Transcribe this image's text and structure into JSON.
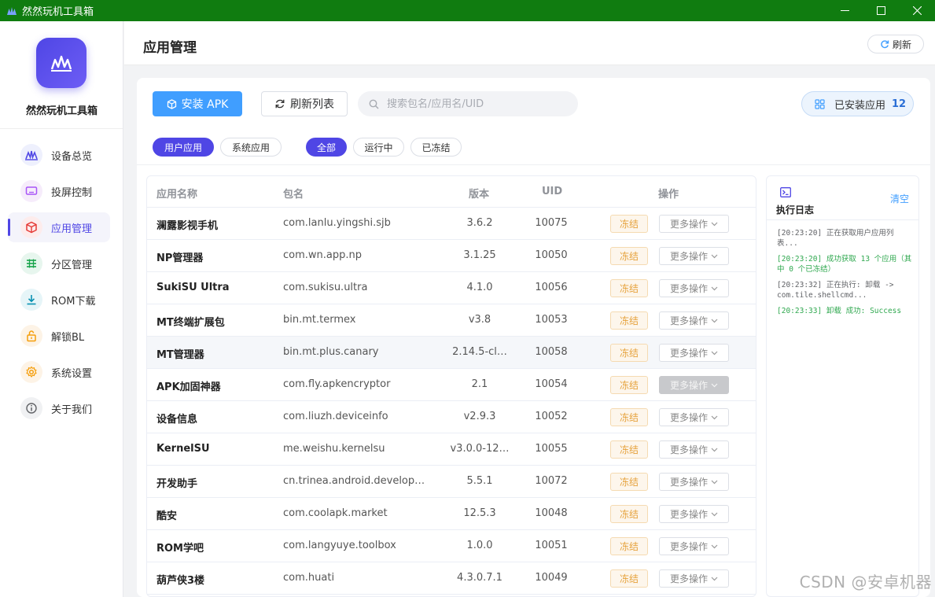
{
  "window": {
    "title": "然然玩机工具箱",
    "minimize_icon": "minimize-icon",
    "maximize_icon": "maximize-icon",
    "close_icon": "close-icon",
    "titlebar_color": "#107c10"
  },
  "sidebar": {
    "logo_title": "然然玩机工具箱",
    "accent": "#4f46e5",
    "items": [
      {
        "label": "设备总览",
        "icon": "chart-icon",
        "active": false
      },
      {
        "label": "投屏控制",
        "icon": "screen-icon",
        "active": false
      },
      {
        "label": "应用管理",
        "icon": "cube-icon",
        "active": true
      },
      {
        "label": "分区管理",
        "icon": "partition-icon",
        "active": false
      },
      {
        "label": "ROM下载",
        "icon": "download-icon",
        "active": false
      },
      {
        "label": "解锁BL",
        "icon": "unlock-icon",
        "active": false
      },
      {
        "label": "系统设置",
        "icon": "gear-icon",
        "active": false
      },
      {
        "label": "关于我们",
        "icon": "info-icon",
        "active": false
      }
    ]
  },
  "header": {
    "title": "应用管理",
    "refresh_label": "刷新"
  },
  "toolbar": {
    "install_label": "安装 APK",
    "refresh_list_label": "刷新列表",
    "search_placeholder": "搜索包名/应用名/UID",
    "search_value": "",
    "installed_label": "已安装应用",
    "installed_count": "12"
  },
  "filters": {
    "type": [
      {
        "label": "用户应用",
        "active": true
      },
      {
        "label": "系统应用",
        "active": false
      }
    ],
    "status": [
      {
        "label": "全部",
        "active": true
      },
      {
        "label": "运行中",
        "active": false
      },
      {
        "label": "已冻结",
        "active": false
      }
    ]
  },
  "table": {
    "columns": [
      "应用名称",
      "包名",
      "版本",
      "UID",
      "操作"
    ],
    "freeze_label": "冻结",
    "more_label": "更多操作",
    "rows": [
      {
        "name": "澜露影视手机",
        "package": "com.lanlu.yingshi.sjb",
        "version": "3.6.2",
        "uid": "10075"
      },
      {
        "name": "NP管理器",
        "package": "com.wn.app.np",
        "version": "3.1.25",
        "uid": "10050"
      },
      {
        "name": "SukiSU Ultra",
        "package": "com.sukisu.ultra",
        "version": "4.1.0",
        "uid": "10056"
      },
      {
        "name": "MT终端扩展包",
        "package": "bin.mt.termex",
        "version": "v3.8",
        "uid": "10053"
      },
      {
        "name": "MT管理器",
        "package": "bin.mt.plus.canary",
        "version": "2.14.5-cl…",
        "uid": "10058"
      },
      {
        "name": "APK加固神器",
        "package": "com.fly.apkencryptor",
        "version": "2.1",
        "uid": "10054"
      },
      {
        "name": "设备信息",
        "package": "com.liuzh.deviceinfo",
        "version": "v2.9.3",
        "uid": "10052"
      },
      {
        "name": "KernelSU",
        "package": "me.weishu.kernelsu",
        "version": "v3.0.0-12…",
        "uid": "10055"
      },
      {
        "name": "开发助手",
        "package": "cn.trinea.android.develop…",
        "version": "5.5.1",
        "uid": "10072"
      },
      {
        "name": "酷安",
        "package": "com.coolapk.market",
        "version": "12.5.3",
        "uid": "10048"
      },
      {
        "name": "ROM学吧",
        "package": "com.langyuye.toolbox",
        "version": "1.0.0",
        "uid": "10051"
      },
      {
        "name": "葫芦侠3楼",
        "package": "com.huati",
        "version": "4.3.0.7.1",
        "uid": "10049"
      }
    ]
  },
  "log": {
    "title": "执行日志",
    "clear_label": "清空",
    "lines": [
      {
        "text": "[20:23:20] 正在获取用户应用列表...",
        "type": "info"
      },
      {
        "text": "[20:23:20] 成功获取 13 个应用（其中 0 个已冻结）",
        "type": "success"
      },
      {
        "text": "[20:23:32] 正在执行: 卸载 -> com.tile.shellcmd...",
        "type": "info"
      },
      {
        "text": "[20:23:33] 卸载 成功: Success",
        "type": "success"
      }
    ]
  },
  "watermark": "CSDN @安卓机器"
}
